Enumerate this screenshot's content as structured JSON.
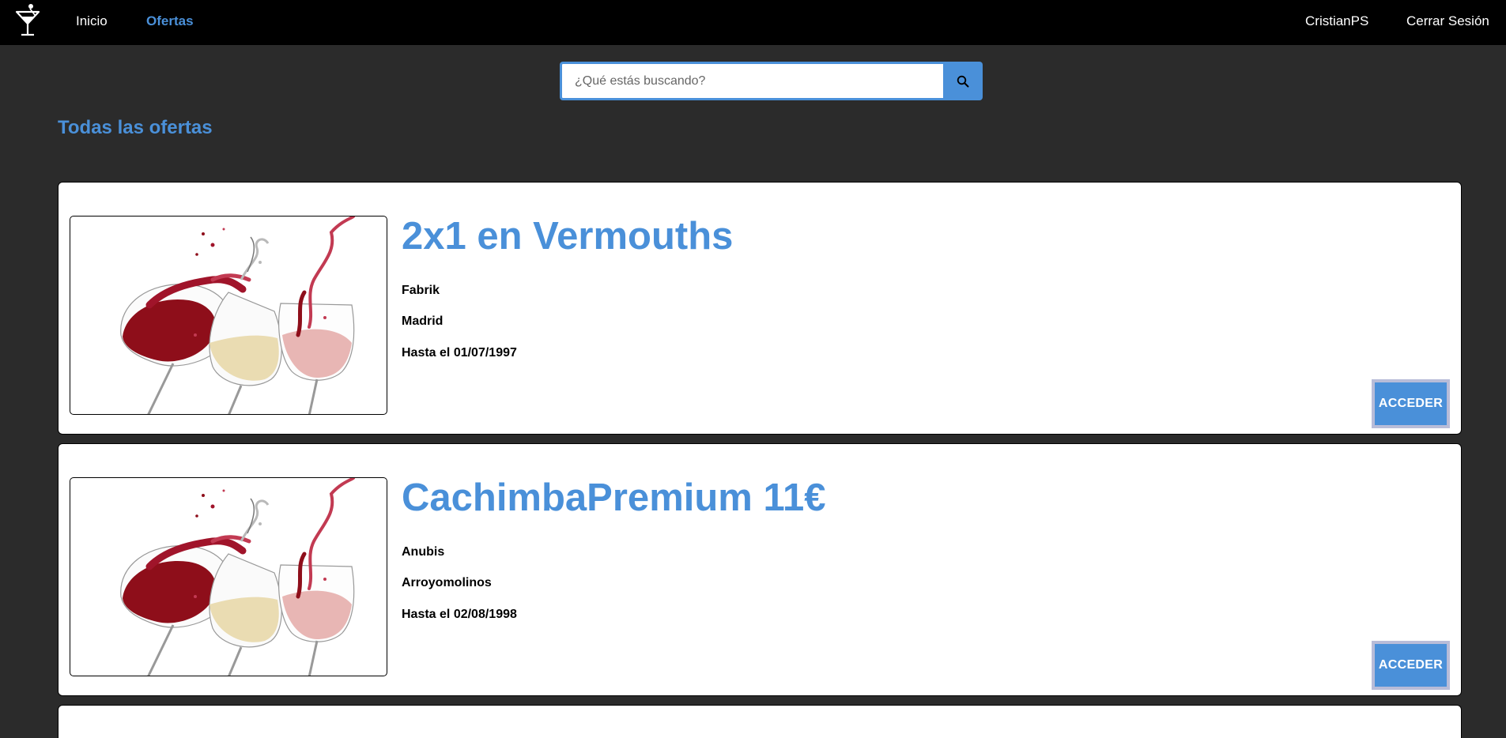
{
  "nav": {
    "logo": "cocktail-glass-icon",
    "links": [
      {
        "label": "Inicio",
        "active": false
      },
      {
        "label": "Ofertas",
        "active": true
      }
    ],
    "user": "CristianPS",
    "logout": "Cerrar Sesión"
  },
  "search": {
    "placeholder": "¿Qué estás buscando?",
    "icon": "search-icon"
  },
  "section_title": "Todas las ofertas",
  "offers": [
    {
      "title": "2x1 en Vermouths",
      "venue": "Fabrik",
      "city": "Madrid",
      "until": "Hasta el 01/07/1997",
      "button": "ACCEDER",
      "image": "wine-glasses-splash-image"
    },
    {
      "title": "CachimbaPremium 11€",
      "venue": "Anubis",
      "city": "Arroyomolinos",
      "until": "Hasta el 02/08/1998",
      "button": "ACCEDER",
      "image": "wine-glasses-splash-image"
    }
  ],
  "colors": {
    "accent": "#4a90d9",
    "navbar": "#000000",
    "background": "#2b2b2b"
  }
}
